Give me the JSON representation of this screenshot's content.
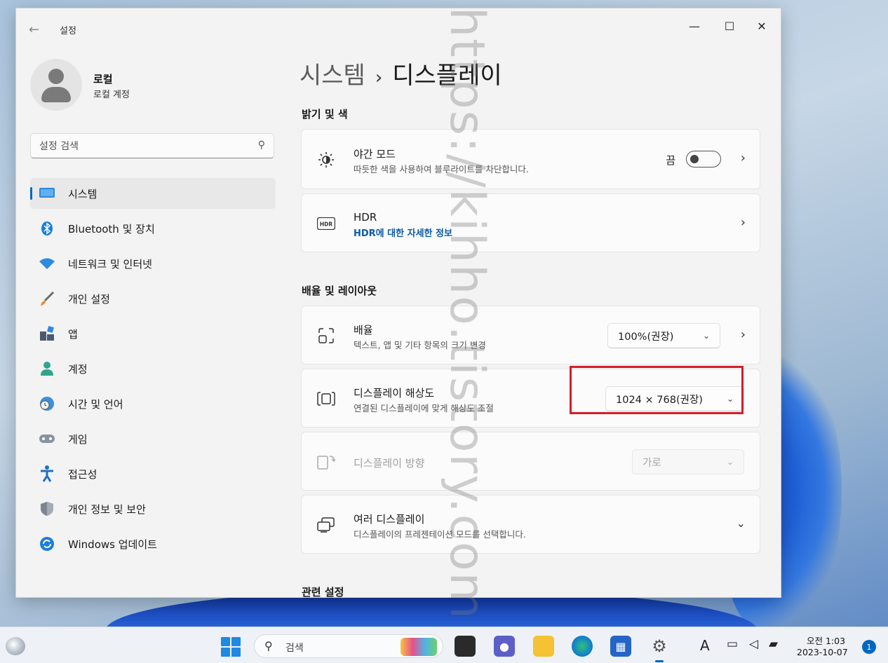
{
  "window": {
    "app_title": "설정",
    "back_icon": "back-arrow-icon",
    "minimize_icon": "minimize-icon",
    "maximize_icon": "maximize-icon",
    "close_icon": "close-icon"
  },
  "profile": {
    "name": "로컬",
    "account_type": "로컬 계정"
  },
  "search": {
    "placeholder": "설정 검색"
  },
  "sidebar": {
    "items": [
      {
        "label": "시스템",
        "icon": "monitor-icon",
        "active": true
      },
      {
        "label": "Bluetooth 및 장치",
        "icon": "bluetooth-icon"
      },
      {
        "label": "네트워크 및 인터넷",
        "icon": "wifi-icon"
      },
      {
        "label": "개인 설정",
        "icon": "brush-icon"
      },
      {
        "label": "앱",
        "icon": "apps-icon"
      },
      {
        "label": "계정",
        "icon": "person-icon"
      },
      {
        "label": "시간 및 언어",
        "icon": "globe-clock-icon"
      },
      {
        "label": "게임",
        "icon": "gamepad-icon"
      },
      {
        "label": "접근성",
        "icon": "accessibility-icon"
      },
      {
        "label": "개인 정보 및 보안",
        "icon": "shield-icon"
      },
      {
        "label": "Windows 업데이트",
        "icon": "update-icon"
      }
    ]
  },
  "main": {
    "breadcrumb": {
      "parent": "시스템",
      "separator": "›",
      "current": "디스플레이"
    },
    "section_brightness": "밝기 및 색",
    "night_mode": {
      "title": "야간 모드",
      "desc": "따듯한 색을 사용하여 블루라이트를 차단합니다.",
      "toggle_label": "끔",
      "toggle_on": false
    },
    "hdr": {
      "title": "HDR",
      "link": "HDR에 대한 자세한 정보",
      "icon_text": "HDR"
    },
    "section_scale": "배율 및 레이아웃",
    "scale": {
      "title": "배율",
      "desc": "텍스트, 앱 및 기타 항목의 크기 변경",
      "value": "100%(권장)"
    },
    "resolution": {
      "title": "디스플레이 해상도",
      "desc": "연결된 디스플레이에 맞게 해상도 조절",
      "value": "1024 × 768(권장)"
    },
    "orientation": {
      "title": "디스플레이 방향",
      "value": "가로"
    },
    "multi_display": {
      "title": "여러 디스플레이",
      "desc": "디스플레이의 프레젠테이션 모드를 선택합니다."
    },
    "section_related": "관련 설정"
  },
  "watermark": "https://kihho.tistory.com",
  "taskbar": {
    "search_label": "검색",
    "clock_time": "오전 1:03",
    "clock_date": "2023-10-07",
    "notification_count": "1",
    "ime_indicator": "A"
  },
  "colors": {
    "accent": "#0067c0",
    "highlight_box": "#d0202a",
    "link": "#0a5aa8"
  }
}
